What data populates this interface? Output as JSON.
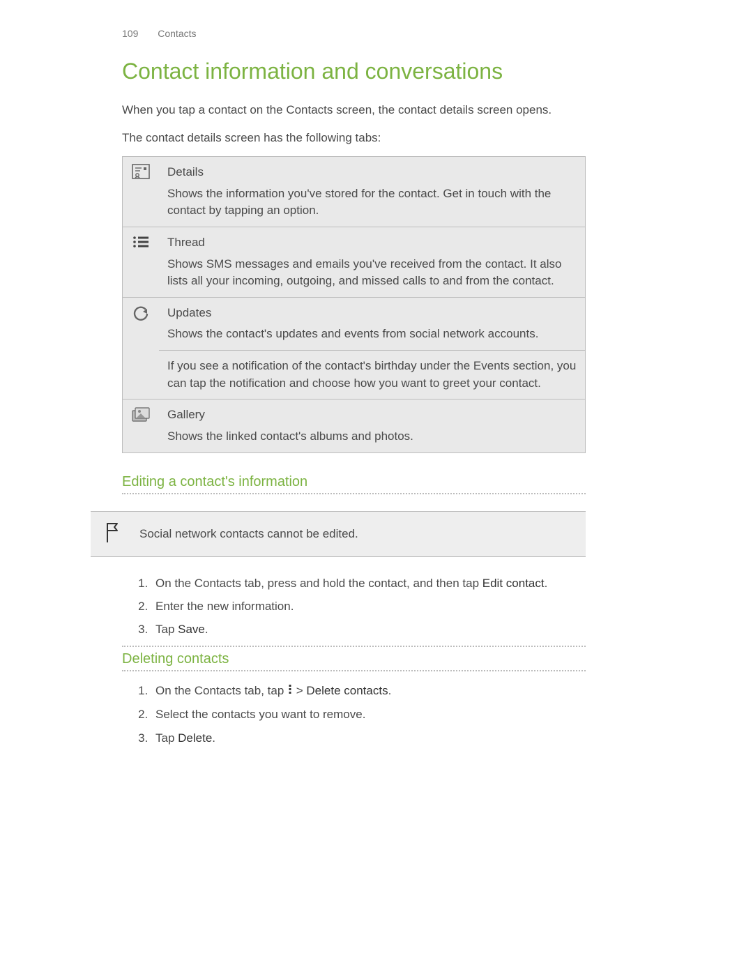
{
  "header": {
    "page_number": "109",
    "section": "Contacts"
  },
  "title": "Contact information and conversations",
  "intro": [
    "When you tap a contact on the Contacts screen, the contact details screen opens.",
    "The contact details screen has the following tabs:"
  ],
  "tabs": [
    {
      "name": "Details",
      "desc": "Shows the information you've stored for the contact. Get in touch with the contact by tapping an option."
    },
    {
      "name": "Thread",
      "desc": "Shows SMS messages and emails you've received from the contact. It also lists all your incoming, outgoing, and missed calls to and from the contact."
    },
    {
      "name": "Updates",
      "desc": "Shows the contact's updates and events from social network accounts.",
      "desc2": "If you see a notification of the contact's birthday under the Events section, you can tap the notification and choose how you want to greet your contact."
    },
    {
      "name": "Gallery",
      "desc": "Shows the linked contact's albums and photos."
    }
  ],
  "sections": {
    "editing": {
      "heading": "Editing a contact's information",
      "note": "Social network contacts cannot be edited.",
      "steps": [
        {
          "pre": "On the Contacts tab, press and hold the contact, and then tap ",
          "bold": "Edit contact",
          "post": "."
        },
        {
          "pre": "Enter the new information."
        },
        {
          "pre": "Tap ",
          "bold": "Save",
          "post": "."
        }
      ]
    },
    "deleting": {
      "heading": "Deleting contacts",
      "steps": [
        {
          "pre": "On the Contacts tab, tap ",
          "icon": "vdots",
          "mid": " > ",
          "bold": "Delete contacts",
          "post": "."
        },
        {
          "pre": "Select the contacts you want to remove."
        },
        {
          "pre": "Tap ",
          "bold": "Delete",
          "post": "."
        }
      ]
    }
  }
}
